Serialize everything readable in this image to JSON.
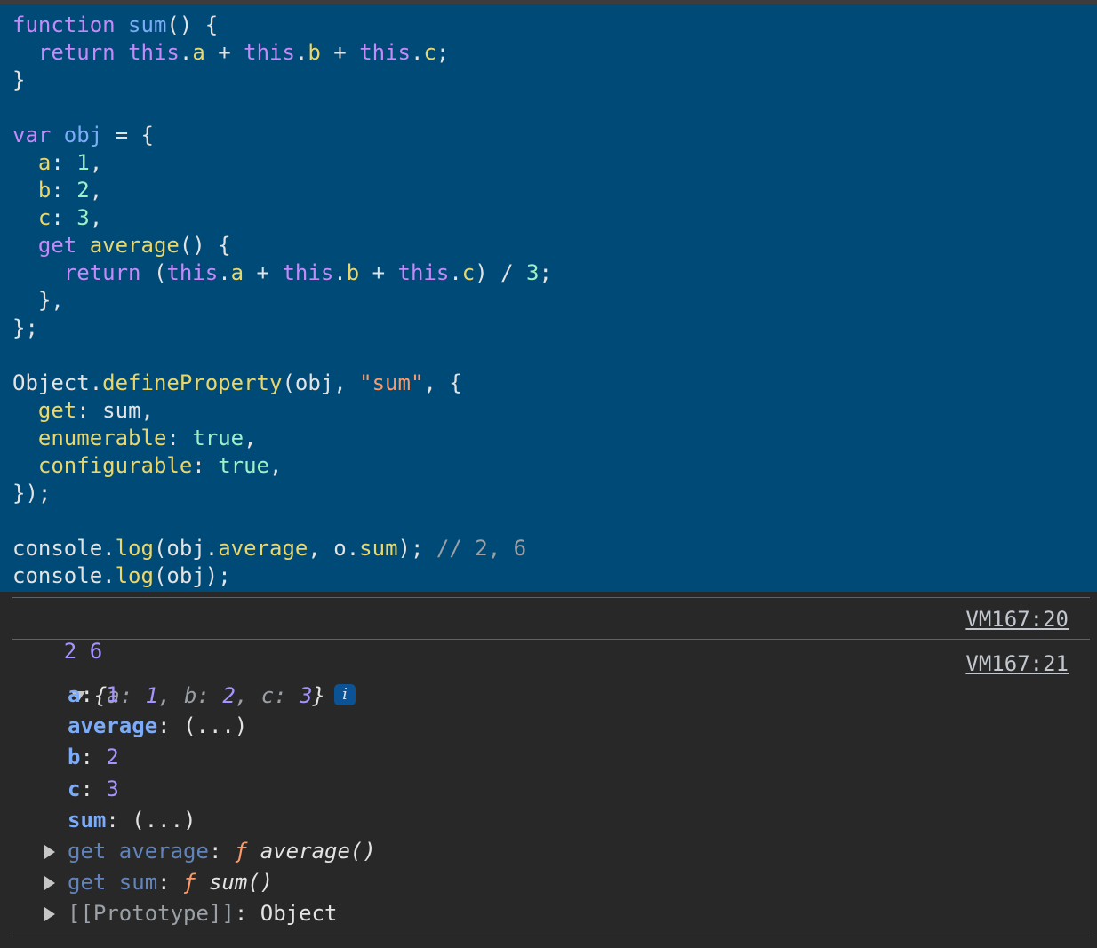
{
  "code_lines": [
    [
      {
        "t": "function ",
        "c": "kw"
      },
      {
        "t": "sum",
        "c": "fn"
      },
      {
        "t": "() {",
        "c": "id"
      }
    ],
    [
      {
        "t": "  ",
        "c": "id"
      },
      {
        "t": "return ",
        "c": "kw"
      },
      {
        "t": "this",
        "c": "kw"
      },
      {
        "t": ".",
        "c": "id"
      },
      {
        "t": "a",
        "c": "prop"
      },
      {
        "t": " + ",
        "c": "id"
      },
      {
        "t": "this",
        "c": "kw"
      },
      {
        "t": ".",
        "c": "id"
      },
      {
        "t": "b",
        "c": "prop"
      },
      {
        "t": " + ",
        "c": "id"
      },
      {
        "t": "this",
        "c": "kw"
      },
      {
        "t": ".",
        "c": "id"
      },
      {
        "t": "c",
        "c": "prop"
      },
      {
        "t": ";",
        "c": "id"
      }
    ],
    [
      {
        "t": "}",
        "c": "id"
      }
    ],
    [],
    [
      {
        "t": "var ",
        "c": "kw"
      },
      {
        "t": "obj",
        "c": "fn"
      },
      {
        "t": " = {",
        "c": "id"
      }
    ],
    [
      {
        "t": "  ",
        "c": "id"
      },
      {
        "t": "a",
        "c": "prop"
      },
      {
        "t": ": ",
        "c": "id"
      },
      {
        "t": "1",
        "c": "num"
      },
      {
        "t": ",",
        "c": "id"
      }
    ],
    [
      {
        "t": "  ",
        "c": "id"
      },
      {
        "t": "b",
        "c": "prop"
      },
      {
        "t": ": ",
        "c": "id"
      },
      {
        "t": "2",
        "c": "num"
      },
      {
        "t": ",",
        "c": "id"
      }
    ],
    [
      {
        "t": "  ",
        "c": "id"
      },
      {
        "t": "c",
        "c": "prop"
      },
      {
        "t": ": ",
        "c": "id"
      },
      {
        "t": "3",
        "c": "num"
      },
      {
        "t": ",",
        "c": "id"
      }
    ],
    [
      {
        "t": "  ",
        "c": "id"
      },
      {
        "t": "get ",
        "c": "kw"
      },
      {
        "t": "average",
        "c": "meth"
      },
      {
        "t": "() {",
        "c": "id"
      }
    ],
    [
      {
        "t": "    ",
        "c": "id"
      },
      {
        "t": "return ",
        "c": "kw"
      },
      {
        "t": "(",
        "c": "id"
      },
      {
        "t": "this",
        "c": "kw"
      },
      {
        "t": ".",
        "c": "id"
      },
      {
        "t": "a",
        "c": "prop"
      },
      {
        "t": " + ",
        "c": "id"
      },
      {
        "t": "this",
        "c": "kw"
      },
      {
        "t": ".",
        "c": "id"
      },
      {
        "t": "b",
        "c": "prop"
      },
      {
        "t": " + ",
        "c": "id"
      },
      {
        "t": "this",
        "c": "kw"
      },
      {
        "t": ".",
        "c": "id"
      },
      {
        "t": "c",
        "c": "prop"
      },
      {
        "t": ") / ",
        "c": "id"
      },
      {
        "t": "3",
        "c": "num"
      },
      {
        "t": ";",
        "c": "id"
      }
    ],
    [
      {
        "t": "  },",
        "c": "id"
      }
    ],
    [
      {
        "t": "};",
        "c": "id"
      }
    ],
    [],
    [
      {
        "t": "Object",
        "c": "id"
      },
      {
        "t": ".",
        "c": "id"
      },
      {
        "t": "defineProperty",
        "c": "meth"
      },
      {
        "t": "(obj, ",
        "c": "id"
      },
      {
        "t": "\"sum\"",
        "c": "str"
      },
      {
        "t": ", {",
        "c": "id"
      }
    ],
    [
      {
        "t": "  ",
        "c": "id"
      },
      {
        "t": "get",
        "c": "prop"
      },
      {
        "t": ": sum,",
        "c": "id"
      }
    ],
    [
      {
        "t": "  ",
        "c": "id"
      },
      {
        "t": "enumerable",
        "c": "prop"
      },
      {
        "t": ": ",
        "c": "id"
      },
      {
        "t": "true",
        "c": "bool"
      },
      {
        "t": ",",
        "c": "id"
      }
    ],
    [
      {
        "t": "  ",
        "c": "id"
      },
      {
        "t": "configurable",
        "c": "prop"
      },
      {
        "t": ": ",
        "c": "id"
      },
      {
        "t": "true",
        "c": "bool"
      },
      {
        "t": ",",
        "c": "id"
      }
    ],
    [
      {
        "t": "});",
        "c": "id"
      }
    ],
    [],
    [
      {
        "t": "console",
        "c": "id"
      },
      {
        "t": ".",
        "c": "id"
      },
      {
        "t": "log",
        "c": "meth"
      },
      {
        "t": "(obj.",
        "c": "id"
      },
      {
        "t": "average",
        "c": "meth"
      },
      {
        "t": ", o.",
        "c": "id"
      },
      {
        "t": "sum",
        "c": "meth"
      },
      {
        "t": "); ",
        "c": "id"
      },
      {
        "t": "// 2, 6",
        "c": "cm"
      }
    ],
    [
      {
        "t": "console",
        "c": "id"
      },
      {
        "t": ".",
        "c": "id"
      },
      {
        "t": "log",
        "c": "meth"
      },
      {
        "t": "(obj);",
        "c": "id"
      }
    ]
  ],
  "console": {
    "log1": {
      "text": "2 6",
      "source": "VM167:20"
    },
    "log2": {
      "source": "VM167:21",
      "preview": {
        "open": "{",
        "a_key": "a",
        "a_val": "1",
        "b_key": "b",
        "b_val": "2",
        "c_key": "c",
        "c_val": "3",
        "close": "}"
      },
      "info_glyph": "i",
      "props": [
        {
          "key": "a",
          "value": "1",
          "kind": "num"
        },
        {
          "key": "average",
          "value": "(...)",
          "kind": "lazy"
        },
        {
          "key": "b",
          "value": "2",
          "kind": "num"
        },
        {
          "key": "c",
          "value": "3",
          "kind": "num"
        },
        {
          "key": "sum",
          "value": "(...)",
          "kind": "lazy"
        }
      ],
      "getters": [
        {
          "label": "get average",
          "fglyph": "ƒ",
          "sig": "average()"
        },
        {
          "label": "get sum",
          "fglyph": "ƒ",
          "sig": "sum()"
        }
      ],
      "prototype": {
        "label": "[[Prototype]]",
        "value": "Object"
      }
    }
  }
}
